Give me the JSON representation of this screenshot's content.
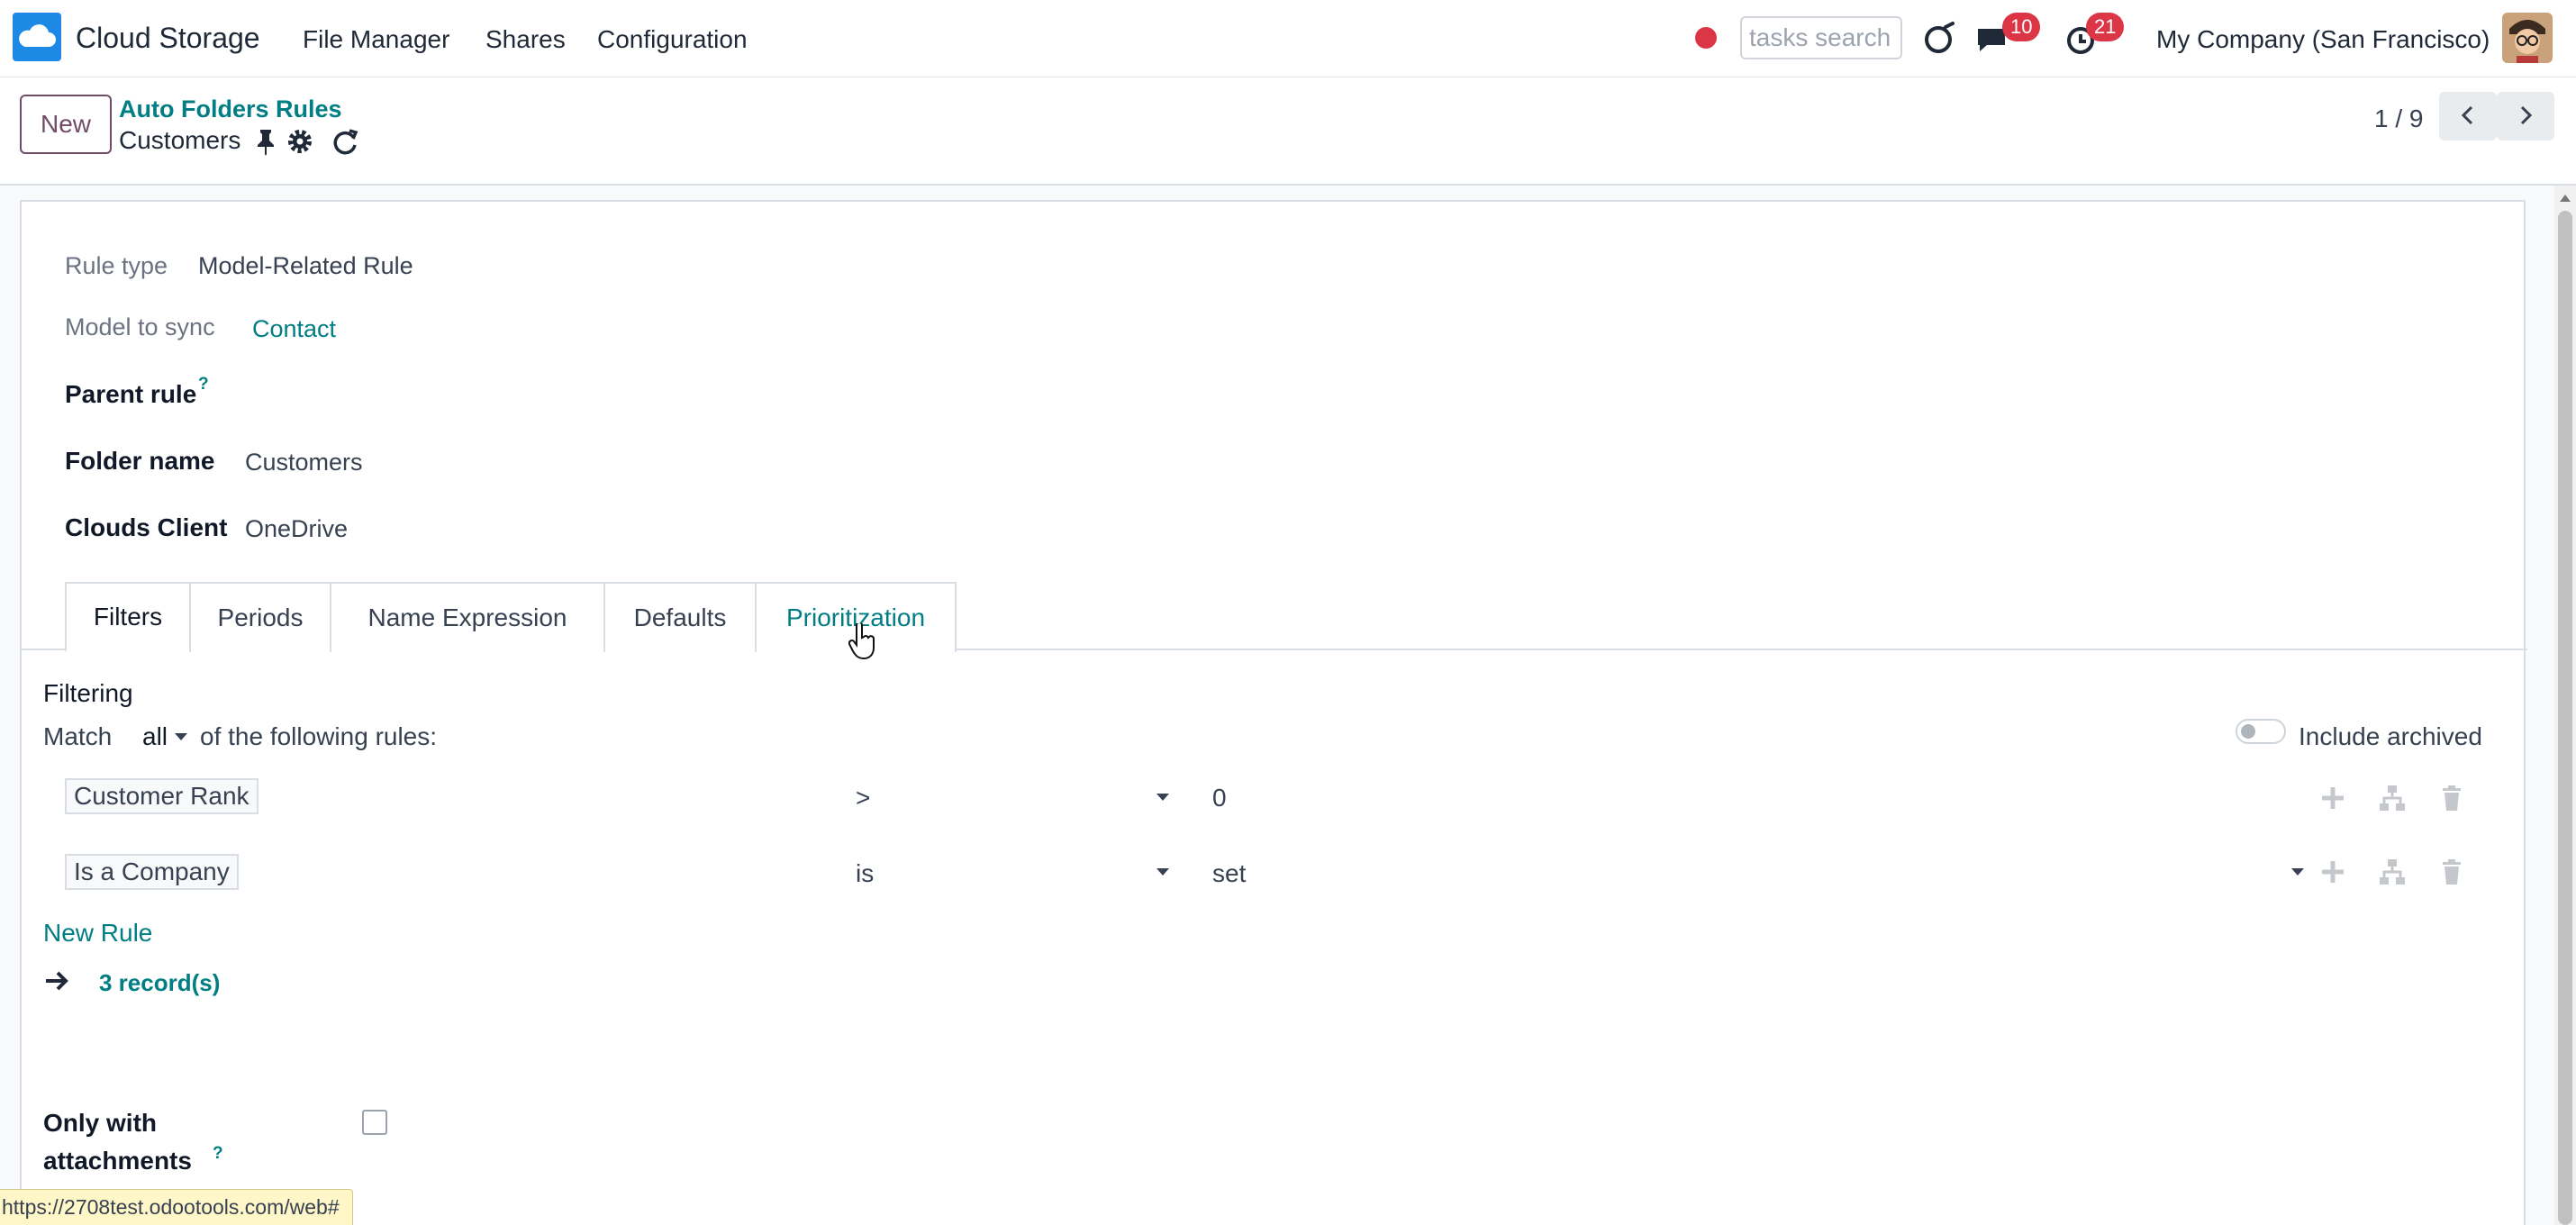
{
  "app": {
    "name": "Cloud Storage"
  },
  "menu": {
    "file_manager": "File Manager",
    "shares": "Shares",
    "configuration": "Configuration"
  },
  "systray": {
    "search_placeholder": "tasks search",
    "messages_count": "10",
    "activities_count": "21",
    "company": "My Company (San Francisco)"
  },
  "control_panel": {
    "new_label": "New",
    "breadcrumb_parent": "Auto Folders Rules",
    "breadcrumb_current": "Customers",
    "pager": "1 / 9"
  },
  "form": {
    "rule_type": {
      "label": "Rule type",
      "value": "Model-Related Rule"
    },
    "model_to_sync": {
      "label": "Model to sync",
      "value": "Contact"
    },
    "parent_rule": {
      "label": "Parent rule",
      "help": "?"
    },
    "folder_name": {
      "label": "Folder name",
      "value": "Customers"
    },
    "clouds_client": {
      "label": "Clouds Client",
      "value": "OneDrive"
    }
  },
  "tabs": [
    "Filters",
    "Periods",
    "Name Expression",
    "Defaults",
    "Prioritization"
  ],
  "filters": {
    "title": "Filtering",
    "match_prefix": "Match",
    "match_value": "all",
    "match_suffix": "of the following rules:",
    "include_archived": "Include archived",
    "rules": [
      {
        "field": "Customer Rank",
        "operator": ">",
        "value": "0"
      },
      {
        "field": "Is a Company",
        "operator": "is",
        "value": "set"
      }
    ],
    "new_rule": "New Rule",
    "records": "3 record(s)"
  },
  "only_attachments": {
    "label_line1": "Only with",
    "label_line2": "attachments",
    "help": "?"
  },
  "status_bar": {
    "url": "https://2708test.odootools.com/web#"
  },
  "colors": {
    "accent": "#017e84",
    "brand": "#714b67",
    "badge": "#dc3545"
  }
}
